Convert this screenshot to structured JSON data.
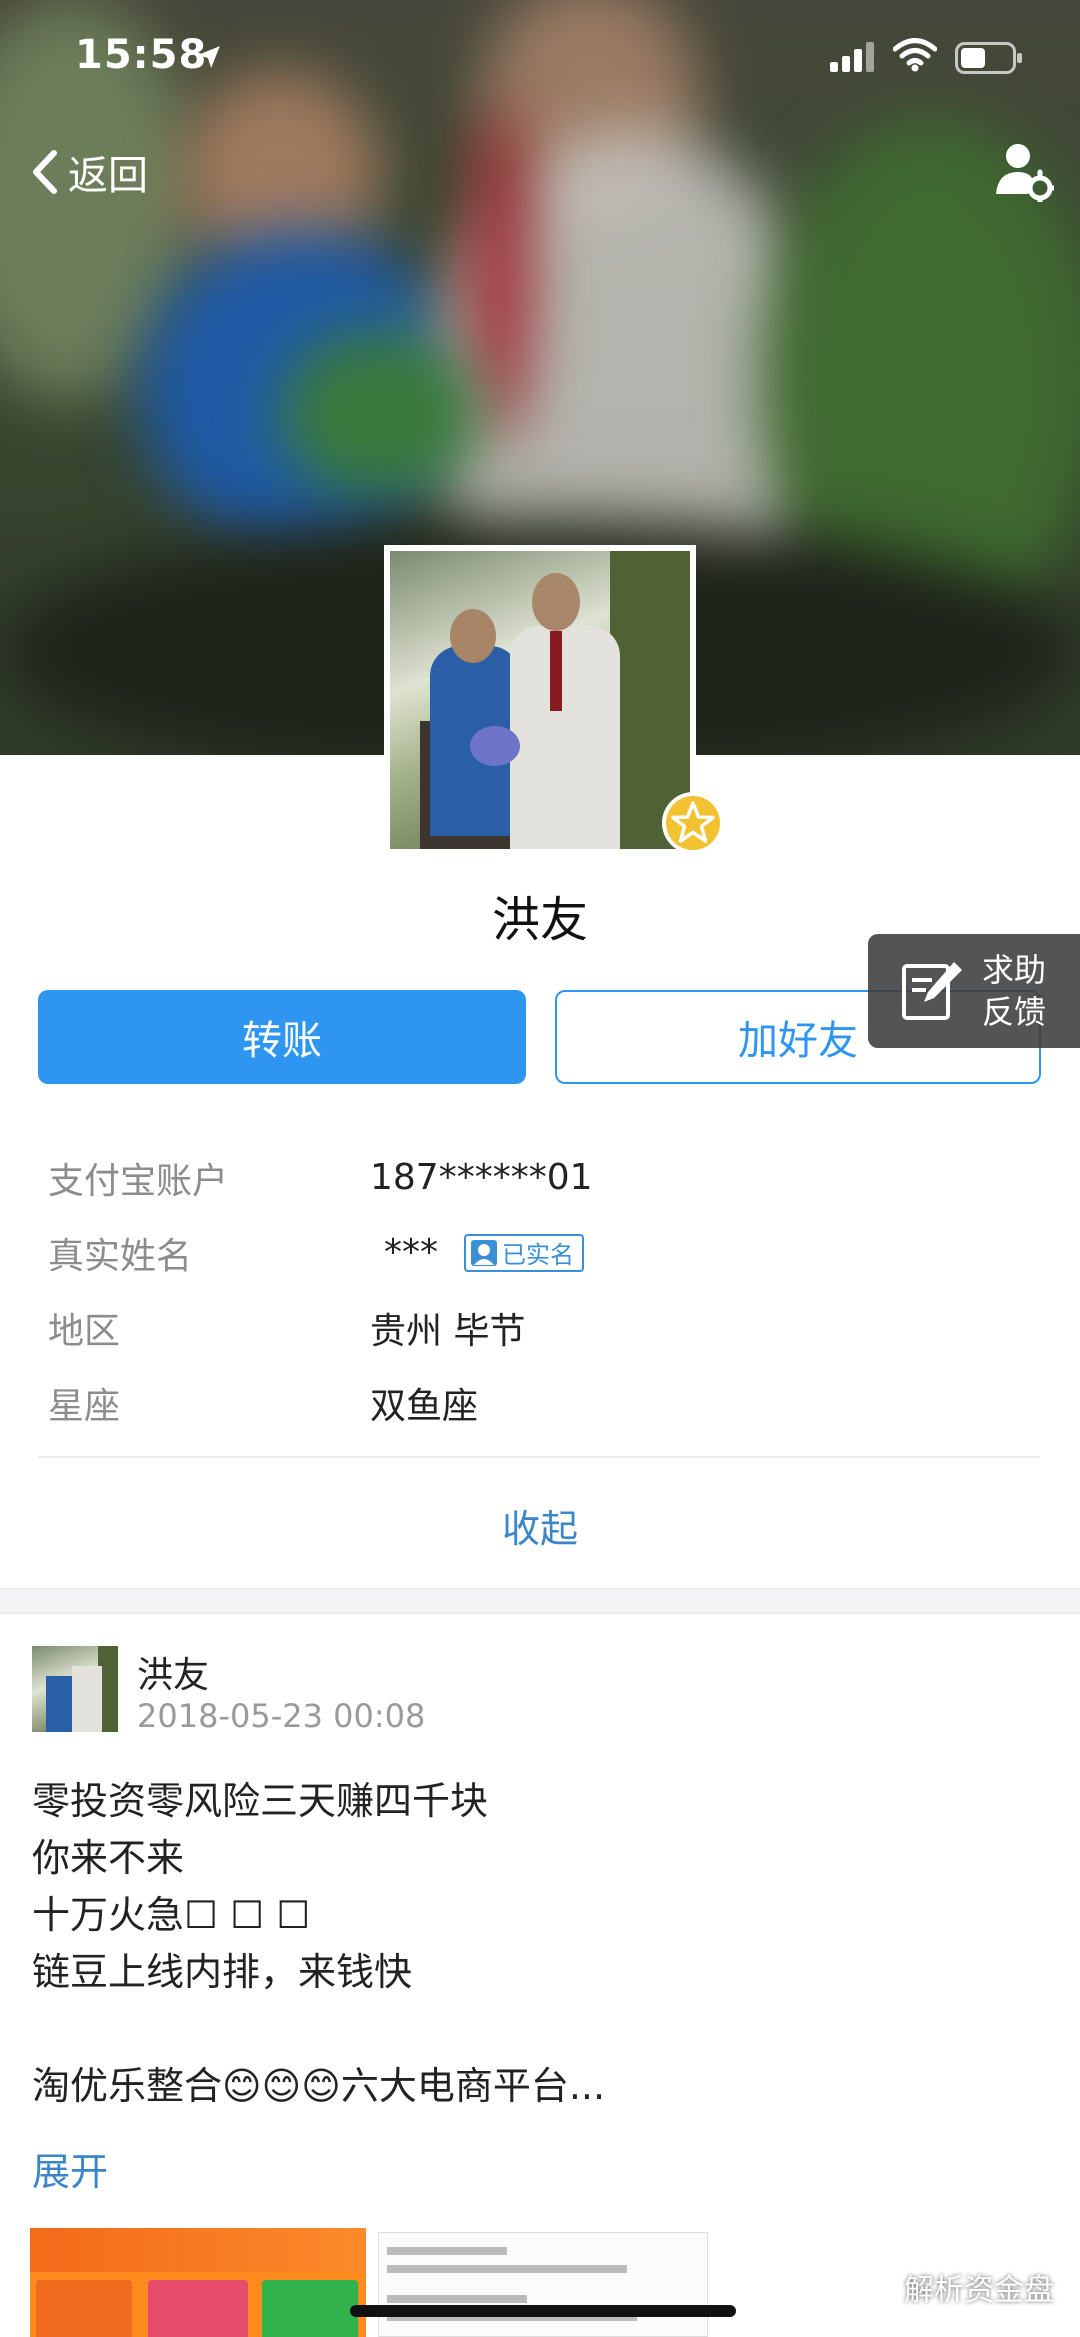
{
  "status_bar": {
    "time": "15:58"
  },
  "nav": {
    "back_label": "返回"
  },
  "profile": {
    "name": "洪友"
  },
  "actions": {
    "transfer_label": "转账",
    "add_friend_label": "加好友"
  },
  "help": {
    "line1": "求助",
    "line2": "反馈"
  },
  "info": {
    "rows": [
      {
        "key": "支付宝账户",
        "value": "187******01"
      },
      {
        "key": "真实姓名",
        "value": "***"
      },
      {
        "key": "地区",
        "value": "贵州 毕节"
      },
      {
        "key": "星座",
        "value": "双鱼座"
      }
    ],
    "verified_label": "已实名",
    "collapse_label": "收起"
  },
  "post": {
    "author": "洪友",
    "time": "2018-05-23 00:08",
    "body": "零投资零风险三天赚四千块\n你来不来\n十万火急☐ ☐ ☐\n链豆上线内排，来钱快\n\n淘优乐整合😊😊😊六大电商平台...",
    "expand_label": "展开"
  },
  "watermark": {
    "text": "解析资金盘"
  },
  "colors": {
    "primary": "#2e96f0",
    "link": "#3a86c6",
    "muted": "#8c8c8c"
  }
}
